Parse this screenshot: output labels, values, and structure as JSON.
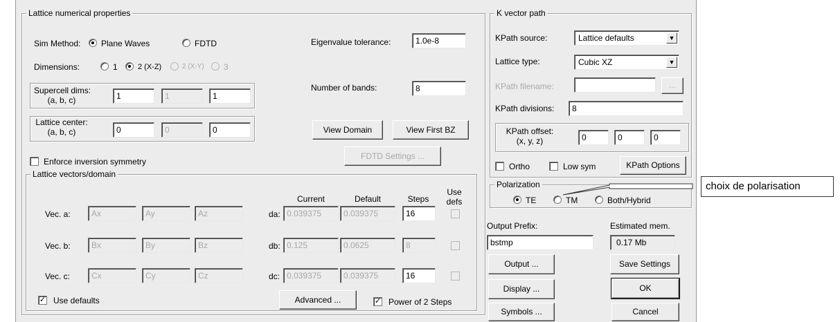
{
  "lattice_props": {
    "title": "Lattice numerical properties",
    "sim_method_label": "Sim Method:",
    "sim_methods": [
      "Plane Waves",
      "FDTD"
    ],
    "dimensions_label": "Dimensions:",
    "dimension_options": [
      "1",
      "2 (X-Z)",
      "2 (X-Y)",
      "3"
    ],
    "supercell_label": "Supercell dims:",
    "supercell_sub": "(a, b, c)",
    "supercell_values": [
      "1",
      "1",
      "1"
    ],
    "lattice_center_label": "Lattice center:",
    "lattice_center_sub": "(a, b, c)",
    "lattice_center_values": [
      "0",
      "0",
      "0"
    ],
    "eigen_tol_label": "Eigenvalue tolerance:",
    "eigen_tol_value": "1.0e-8",
    "bands_label": "Number of bands:",
    "bands_value": "8",
    "view_domain": "View Domain",
    "view_first_bz": "View First BZ",
    "fdtd_settings": "FDTD Settings ...",
    "enforce_inversion": "Enforce inversion symmetry"
  },
  "lattice_vectors": {
    "title": "Lattice vectors/domain",
    "col_current": "Current",
    "col_default": "Default",
    "col_steps": "Steps",
    "col_use_defs_1": "Use",
    "col_use_defs_2": "defs",
    "rows": [
      {
        "label": "Vec. a:",
        "c1": "Ax",
        "c2": "Ay",
        "c3": "Az",
        "d_label": "da:",
        "current": "0.039375",
        "default": "0.039375",
        "steps": "16"
      },
      {
        "label": "Vec. b:",
        "c1": "Bx",
        "c2": "By",
        "c3": "Bz",
        "d_label": "db:",
        "current": "0.125",
        "default": "0.0625",
        "steps": "8"
      },
      {
        "label": "Vec. c:",
        "c1": "Cx",
        "c2": "Cy",
        "c3": "Cz",
        "d_label": "dc:",
        "current": "0.039375",
        "default": "0.039375",
        "steps": "16"
      }
    ],
    "use_defaults": "Use defaults",
    "advanced": "Advanced ...",
    "power_of_2": "Power of 2 Steps"
  },
  "kpath": {
    "title": "K vector path",
    "source_label": "KPath source:",
    "source_value": "Lattice defaults",
    "lattice_type_label": "Lattice type:",
    "lattice_type_value": "Cubic XZ",
    "filename_label": "KPath filename:",
    "filename_button": "...",
    "divisions_label": "KPath divisions:",
    "divisions_value": "8",
    "offset_label": "KPath offset:",
    "offset_sub": "(x, y, z)",
    "offset_values": [
      "0",
      "0",
      "0"
    ],
    "ortho": "Ortho",
    "low_sym": "Low sym",
    "options": "KPath Options"
  },
  "polarization": {
    "title": "Polarization",
    "options": [
      "TE",
      "TM",
      "Both/Hybrid"
    ]
  },
  "output": {
    "prefix_label": "Output Prefix:",
    "prefix_value": "bstmp",
    "mem_label": "Estimated mem.",
    "mem_value": "0.17 Mb",
    "output_btn": "Output ...",
    "save_btn": "Save Settings",
    "display_btn": "Display ...",
    "ok_btn": "OK",
    "symbols_btn": "Symbols ...",
    "cancel_btn": "Cancel"
  },
  "annotation": {
    "text": "choix de polarisation"
  }
}
